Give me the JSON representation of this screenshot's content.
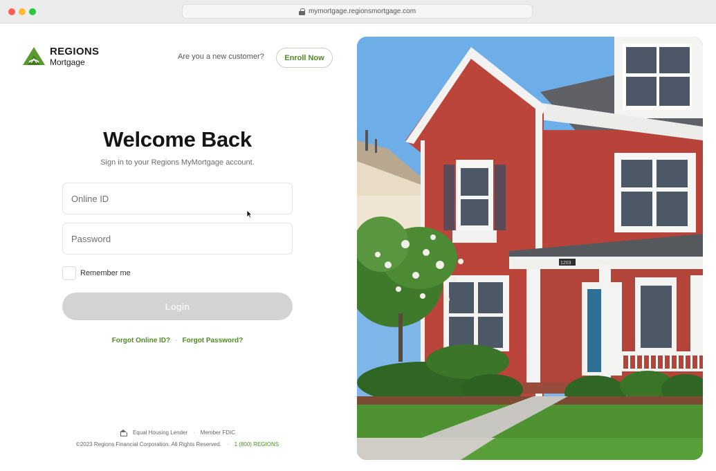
{
  "browser": {
    "url": "mymortgage.regionsmortgage.com"
  },
  "brand": {
    "name": "REGIONS",
    "product": "Mortgage",
    "green": "#4f8a27"
  },
  "header": {
    "new_customer_text": "Are you a new customer?",
    "enroll_label": "Enroll Now"
  },
  "login": {
    "title": "Welcome Back",
    "subtitle": "Sign in to your Regions MyMortgage account.",
    "online_id_placeholder": "Online ID",
    "password_placeholder": "Password",
    "remember_label": "Remember me",
    "remember_checked": false,
    "login_label": "Login",
    "forgot_id_label": "Forgot Online ID?",
    "forgot_password_label": "Forgot Password?",
    "separator": "·"
  },
  "footer": {
    "equal_housing": "Equal Housing Lender",
    "member_fdic": "Member FDIC",
    "copyright": "©2023 Regions Financial Corporation. All Rights Reserved.",
    "phone": "1 (800) REGIONS",
    "separator": "·"
  },
  "photo": {
    "house_number": "1203"
  },
  "icons": {
    "lock": "lock-icon",
    "logo": "regions-logo-icon",
    "house": "equal-housing-icon",
    "cursor": "mouse-cursor-icon"
  }
}
